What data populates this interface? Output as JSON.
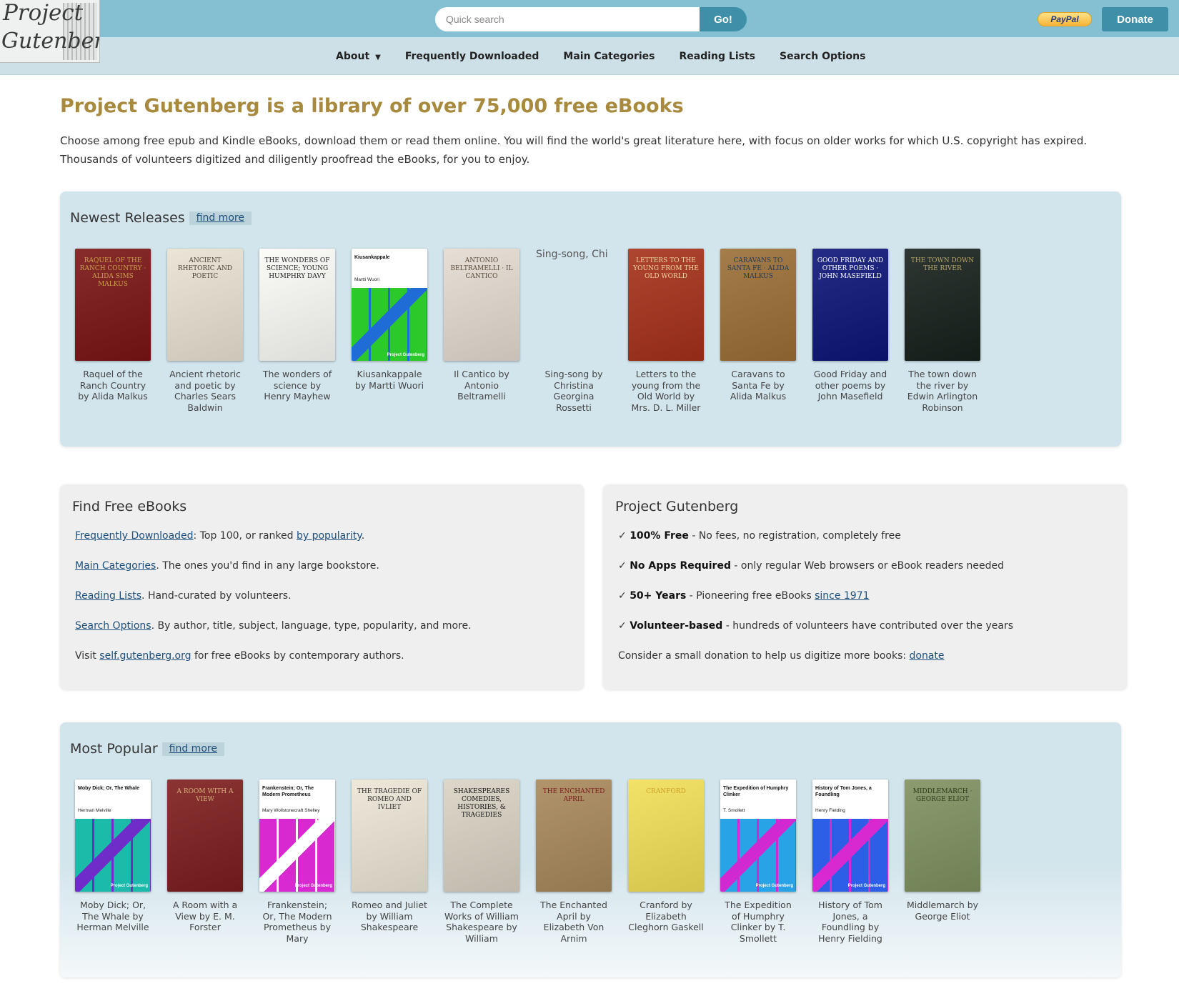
{
  "header": {
    "logo_line1": "Project",
    "logo_line2": "Gutenberg",
    "search_placeholder": "Quick search",
    "search_button": "Go!",
    "paypal_label": "PayPal",
    "donate_label": "Donate",
    "nav": [
      {
        "label": "About",
        "has_dropdown": true,
        "icon": "caret-down-icon"
      },
      {
        "label": "Frequently Downloaded"
      },
      {
        "label": "Main Categories"
      },
      {
        "label": "Reading Lists"
      },
      {
        "label": "Search Options"
      }
    ]
  },
  "intro": {
    "headline": "Project Gutenberg is a library of over 75,000 free eBooks",
    "body": "Choose among free epub and Kindle eBooks, download them or read them online. You will find the world's great literature here, with focus on older works for which U.S. copyright has expired. Thousands of volunteers digitized and diligently proofread the eBooks, for you to enjoy."
  },
  "newest": {
    "title": "Newest Releases",
    "find_more": "find more",
    "books": [
      {
        "label": "Raquel of the Ranch Country by Alida Malkus",
        "cover_text": "Raquel of the Ranch Country · Alida Sims Malkus",
        "cover_color": "#7a1414",
        "ink": "#c9a24a"
      },
      {
        "label": "Ancient rhetoric and poetic by Charles Sears Baldwin",
        "cover_text": "Ancient Rhetoric and Poetic",
        "cover_color": "#e8e2d2",
        "ink": "#4a4336"
      },
      {
        "label": "The wonders of science by Henry Mayhew",
        "cover_text": "The Wonders of Science; Young Humphry Davy",
        "cover_color": "#fbfbf8",
        "ink": "#222"
      },
      {
        "label": "Kiusankappale by Martti Wuori",
        "generated": true,
        "cover_title": "Kiusankappale",
        "cover_author": "Martti Wuori",
        "art": "green",
        "badge": "Project Gutenberg"
      },
      {
        "label": "Il Cantico by Antonio Beltramelli",
        "cover_text": "Antonio Beltramelli · Il Cantico",
        "cover_color": "#e4dbd0",
        "ink": "#5a4a3a"
      },
      {
        "label": "Sing-song by Christina Georgina Rossetti",
        "broken": true,
        "alt": "Sing-song, Chi"
      },
      {
        "label": "Letters to the young from the Old World by Mrs. D. L. Miller",
        "cover_text": "Letters to the Young from the Old World",
        "cover_color": "#a5301a",
        "ink": "#f1d9a0"
      },
      {
        "label": "Caravans to Santa Fe by Alida Malkus",
        "cover_text": "Caravans to Santa Fe · Alida Malkus",
        "cover_color": "#9b6e35",
        "ink": "#1f3b5a"
      },
      {
        "label": "Good Friday and other poems by John Masefield",
        "cover_text": "Good Friday and other poems · John Masefield",
        "cover_color": "#0b1477",
        "ink": "#ffffff"
      },
      {
        "label": "The town down the river by Edwin Arlington Robinson",
        "cover_text": "The Town Down the River",
        "cover_color": "#17201c",
        "ink": "#b8a56a"
      }
    ]
  },
  "find_free": {
    "title": "Find Free eBooks",
    "lines": [
      {
        "link": "Frequently Downloaded",
        "text": ": Top 100, or ranked ",
        "link2": "by popularity",
        "text2": "."
      },
      {
        "link": "Main Categories",
        "text": ". The ones you'd find in any large bookstore."
      },
      {
        "link": "Reading Lists",
        "text": ". Hand-curated by volunteers."
      },
      {
        "link": "Search Options",
        "text": ". By author, title, subject, language, type, popularity, and more."
      },
      {
        "pre": "Visit ",
        "link": "self.gutenberg.org",
        "text": " for free eBooks by contemporary authors."
      }
    ]
  },
  "pg": {
    "title": "Project Gutenberg",
    "lines": [
      {
        "check": "✓",
        "bold": "100% Free",
        "text": " - No fees, no registration, completely free"
      },
      {
        "check": "✓",
        "bold": "No Apps Required",
        "text": " - only regular Web browsers or eBook readers needed"
      },
      {
        "check": "✓",
        "bold": "50+ Years",
        "text": " - Pioneering free eBooks ",
        "link": "since 1971"
      },
      {
        "check": "✓",
        "bold": "Volunteer-based",
        "text": " - hundreds of volunteers have contributed over the years"
      },
      {
        "pre": "Consider a small donation to help us digitize more books: ",
        "link": "donate"
      }
    ]
  },
  "popular": {
    "title": "Most Popular",
    "find_more": "find more",
    "books": [
      {
        "label": "Moby Dick; Or, The Whale by Herman Melville",
        "generated": true,
        "cover_title": "Moby Dick; Or, The Whale",
        "cover_author": "Herman Melville",
        "art": "teal",
        "badge": "Project Gutenberg"
      },
      {
        "label": "A Room with a View by E. M. Forster",
        "cover_text": "A Room with a View",
        "cover_color": "#7d1d1d",
        "ink": "#d6b27a"
      },
      {
        "label": "Frankenstein; Or, The Modern Prometheus by Mary",
        "generated": true,
        "cover_title": "Frankenstein; Or, The Modern Prometheus",
        "cover_author": "Mary Wollstonecraft Shelley",
        "art": "magenta",
        "badge": "Project Gutenberg"
      },
      {
        "label": "Romeo and Juliet by William Shakespeare",
        "cover_text": "The Tragedie of Romeo and Ivliet",
        "cover_color": "#ece6d6",
        "ink": "#2b2b2b"
      },
      {
        "label": "The Complete Works of William Shakespeare by William",
        "cover_text": "Shakespeares Comedies, Histories, & Tragedies",
        "cover_color": "#d9d3c4",
        "ink": "#111"
      },
      {
        "label": "The Enchanted April by Elizabeth Von Arnim",
        "cover_text": "The Enchanted April",
        "cover_color": "#a8885a",
        "ink": "#7a1b1b"
      },
      {
        "label": "Cranford by Elizabeth Cleghorn Gaskell",
        "cover_text": "Cranford",
        "cover_color": "#f2df57",
        "ink": "#c9a227"
      },
      {
        "label": "The Expedition of Humphry Clinker by T. Smollett",
        "generated": true,
        "cover_title": "The Expedition of Humphry Clinker",
        "cover_author": "T. Smollett",
        "art": "blue",
        "badge": "Project Gutenberg"
      },
      {
        "label": "History of Tom Jones, a Foundling by Henry Fielding",
        "generated": true,
        "cover_title": "History of Tom Jones, a Foundling",
        "cover_author": "Henry Fielding",
        "art": "violet",
        "badge": "Project Gutenberg"
      },
      {
        "label": "Middlemarch by George Eliot",
        "cover_text": "Middlemarch · George Eliot",
        "cover_color": "#7f9160",
        "ink": "#2d3a1c"
      }
    ]
  },
  "colors": {
    "topbar": "#84c0d2",
    "navbar": "#cde0e7",
    "accent_button": "#3f8fa9",
    "headline": "#a88a3e",
    "book_panel": "#d2e5ec",
    "info_panel": "#efefef"
  }
}
